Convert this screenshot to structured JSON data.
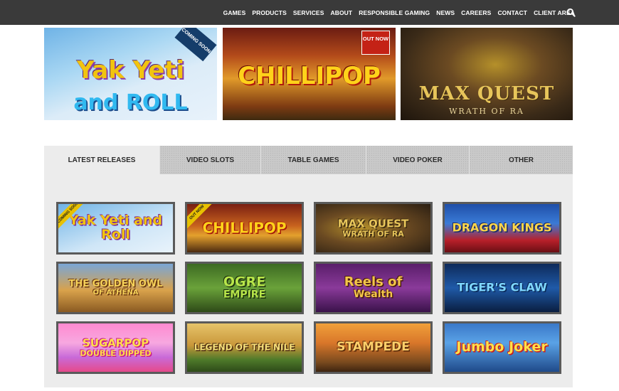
{
  "nav": {
    "items": [
      {
        "label": "GAMES",
        "active": true
      },
      {
        "label": "PRODUCTS",
        "active": false
      },
      {
        "label": "SERVICES",
        "active": false
      },
      {
        "label": "ABOUT",
        "active": false
      },
      {
        "label": "RESPONSIBLE GAMING",
        "active": false
      },
      {
        "label": "NEWS",
        "active": false
      },
      {
        "label": "CAREERS",
        "active": false
      },
      {
        "label": "CONTACT",
        "active": false
      },
      {
        "label": "CLIENT AREA",
        "active": false
      }
    ],
    "search_icon": "search-icon",
    "active_color": "#e6c800"
  },
  "hero": {
    "banner1": {
      "title": "Yak Yeti",
      "subtitle": "and ROLL",
      "tag": "COMING SOON"
    },
    "banner2": {
      "title": "CHILLIPOP",
      "tag": "OUT NOW"
    },
    "banner3": {
      "title": "MAX QUEST",
      "subtitle": "WRATH OF RA"
    }
  },
  "tabs": [
    {
      "label": "LATEST RELEASES",
      "active": true
    },
    {
      "label": "VIDEO SLOTS",
      "active": false
    },
    {
      "label": "TABLE GAMES",
      "active": false
    },
    {
      "label": "VIDEO POKER",
      "active": false
    },
    {
      "label": "OTHER",
      "active": false
    }
  ],
  "games": [
    {
      "title": "Yak Yeti and Roll",
      "badge": "COMING SOON",
      "bg": "linear-gradient(160deg,#6fb3e6,#cfe6f7 60%,#e9f3fb)",
      "color": "#f1c40f",
      "shadow": "#7c2f9c",
      "size": 19
    },
    {
      "title": "CHILLIPOP",
      "badge": "OUT NOW",
      "bg": "linear-gradient(180deg,#7a1f12,#c8621e 45%,#e4a12d 65%,#4b2a10)",
      "color": "#ffd21a",
      "shadow": "#a3180a",
      "size": 20
    },
    {
      "title": "MAX QUEST",
      "sub": "WRATH OF RA",
      "bg": "radial-gradient(ellipse at 40% 50%,#b5902a,#6b4a22 45%,#2a1e12)",
      "color": "#e7c55a",
      "shadow": "#3d2a10",
      "size": 15
    },
    {
      "title": "DRAGON KINGS",
      "bg": "linear-gradient(180deg,#1f4fa8,#3a7ad6 40%,#b8202a 75%,#6a0f14)",
      "color": "#ffd74a",
      "shadow": "#1a2d6a",
      "size": 16
    },
    {
      "title": "THE GOLDEN OWL",
      "sub": "OF ATHENA",
      "bg": "linear-gradient(180deg,#7aa6d6,#d9a24b 55%,#8a5a22)",
      "color": "#f6d25a",
      "shadow": "#6b3a12",
      "size": 13
    },
    {
      "title": "OGRE",
      "sub": "EMPIRE",
      "bg": "linear-gradient(180deg,#3d6a22,#6aa23a 50%,#2e4a18)",
      "color": "#b8e64a",
      "shadow": "#1d3210",
      "size": 19
    },
    {
      "title": "Reels of",
      "sub": "Wealth",
      "bg": "linear-gradient(180deg,#5a1e6a,#8a3a9a 50%,#3a124a)",
      "color": "#f3c64a",
      "shadow": "#4a1a10",
      "size": 18
    },
    {
      "title": "TIGER'S CLAW",
      "bg": "linear-gradient(180deg,#0e2a5a,#1f5aa8 50%,#0a1e40)",
      "color": "#7fd8ff",
      "shadow": "#0a2a5a",
      "size": 16
    },
    {
      "title": "SUGARPOP",
      "sub": "DOUBLE DIPPED",
      "bg": "linear-gradient(180deg,#ff8ad0,#f7a8e0 40%,#c86ad8 70%,#e64a8a)",
      "color": "#ffe14a",
      "shadow": "#c8208a",
      "size": 15
    },
    {
      "title": "LEGEND OF THE NILE",
      "bg": "linear-gradient(180deg,#e6c46a,#c9973a 45%,#4e7a2a 75%,#2e4a18)",
      "color": "#f6e07a",
      "shadow": "#4a2a10",
      "size": 12
    },
    {
      "title": "STAMPEDE",
      "bg": "linear-gradient(180deg,#f0a03a,#d9772a 40%,#7a4a1e 80%,#3e2410)",
      "color": "#ffd06a",
      "shadow": "#5a2a0a",
      "size": 17
    },
    {
      "title": "Jumbo Joker",
      "bg": "linear-gradient(180deg,#3a78c8,#5aa2e6 40%,#1f4a8a)",
      "color": "#ffe14a",
      "shadow": "#c82020",
      "size": 19
    }
  ]
}
